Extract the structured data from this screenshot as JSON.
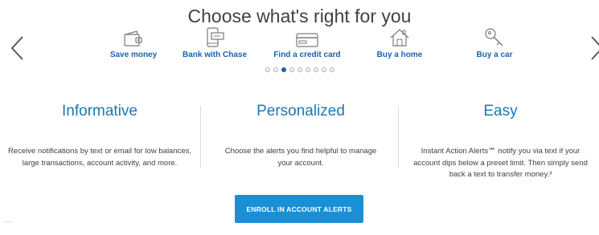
{
  "carousel": {
    "title": "Choose what's right for you",
    "prev_icon": "chevron-left-icon",
    "next_icon": "chevron-right-icon",
    "categories": [
      {
        "label": "Save money",
        "icon": "wallet-icon"
      },
      {
        "label": "Bank with Chase",
        "icon": "mobile-check-icon"
      },
      {
        "label": "Find a credit card",
        "icon": "credit-card-icon"
      },
      {
        "label": "Buy a home",
        "icon": "house-icon"
      },
      {
        "label": "Buy a car",
        "icon": "car-key-icon"
      }
    ],
    "page_count": 9,
    "active_page": 3
  },
  "features": [
    {
      "title": "Informative",
      "text": "Receive notifications by text or email for low balances, large transactions, account activity, and more."
    },
    {
      "title": "Personalized",
      "text": "Choose the alerts you find helpful to manage your account."
    },
    {
      "title": "Easy",
      "text": "Instant Action Alerts℠ notify you via text if your account dips below a preset limit. Then simply send back a text to transfer money.³"
    }
  ],
  "cta": {
    "label": "ENROLL IN ACCOUNT ALERTS"
  },
  "colors": {
    "link": "#1a64b0",
    "heading": "#1a78b5",
    "button": "#1a8fd6",
    "active_dot": "#1f5ea8"
  }
}
